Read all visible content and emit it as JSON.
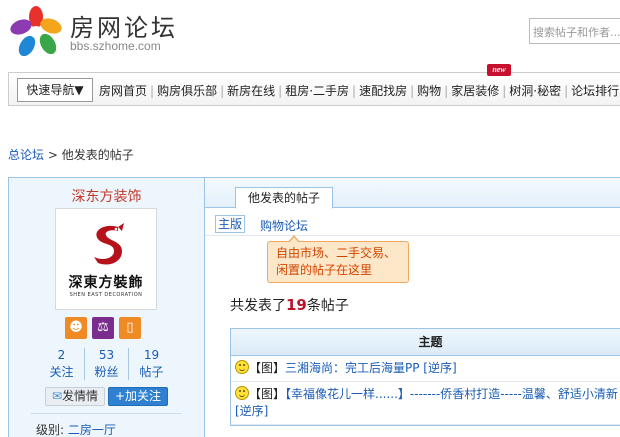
{
  "header": {
    "site_name": "房网论坛",
    "site_url": "bbs.szhome.com",
    "search_placeholder": "搜索帖子和作者..."
  },
  "nav": {
    "quick_nav_label": "快速导航▼",
    "new_badge": "new",
    "links": [
      "房网首页",
      "购房俱乐部",
      "新房在线",
      "租房·二手房",
      "速配找房",
      "购物",
      "家居装修",
      "树洞·秘密",
      "论坛排行"
    ]
  },
  "breadcrumb": {
    "root": "总论坛",
    "separator": " > ",
    "current": "他发表的帖子"
  },
  "profile": {
    "name": "深东方装饰",
    "avatar_title": "深東方裝飾",
    "avatar_subtitle": "SHEN EAST DECORATION",
    "badges": [
      {
        "icon": "user-icon",
        "color": "#f08a24"
      },
      {
        "icon": "scale-icon",
        "color": "#7b2d8e"
      },
      {
        "icon": "phone-icon",
        "color": "#f08a24"
      }
    ],
    "stats": [
      {
        "value": "2",
        "label": "关注"
      },
      {
        "value": "53",
        "label": "粉丝"
      },
      {
        "value": "19",
        "label": "帖子"
      }
    ],
    "message_button": "发情情",
    "follow_button": "+加关注",
    "level_label": "级别:",
    "level_value": "二房一厅"
  },
  "content": {
    "active_tab": "他发表的帖子",
    "subtab_main": "主版",
    "subtab_shop": "购物论坛",
    "tooltip_line1": "自由市场、二手交易、",
    "tooltip_line2": "闲置的帖子在这里",
    "post_count_prefix": "共发表了",
    "post_count": "19",
    "post_count_suffix": "条帖子",
    "table_header": "主题",
    "rows": [
      {
        "tag": "【图】",
        "title": "三湘海尚：完工后海量PP [逆序]"
      },
      {
        "tag": "【图】",
        "title": "【幸福像花儿一样......】-------侨香村打造-----温馨、舒适小清新 [逆序]"
      }
    ]
  },
  "colors": {
    "link_blue": "#1a5cb5",
    "name_red": "#c0392b",
    "count_red": "#b8142c",
    "follow_blue": "#2f80d1",
    "border_blue": "#9cc4e6"
  }
}
